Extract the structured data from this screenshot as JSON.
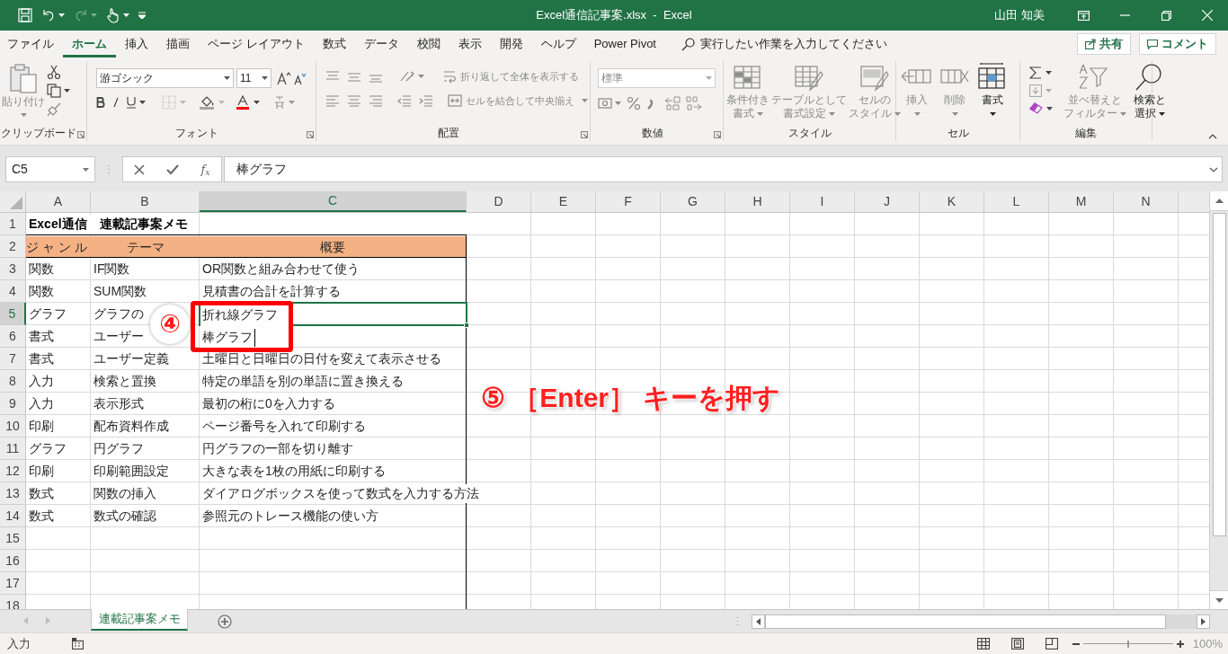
{
  "title_bar": {
    "title": "Excel通信記事案.xlsx  -  Excel",
    "user": "山田 知美"
  },
  "tabs": [
    {
      "label": "ファイル",
      "selected": false
    },
    {
      "label": "ホーム",
      "selected": true
    },
    {
      "label": "挿入",
      "selected": false
    },
    {
      "label": "描画",
      "selected": false
    },
    {
      "label": "ページ レイアウト",
      "selected": false
    },
    {
      "label": "数式",
      "selected": false
    },
    {
      "label": "データ",
      "selected": false
    },
    {
      "label": "校閲",
      "selected": false
    },
    {
      "label": "表示",
      "selected": false
    },
    {
      "label": "開発",
      "selected": false
    },
    {
      "label": "ヘルプ",
      "selected": false
    },
    {
      "label": "Power Pivot",
      "selected": false
    }
  ],
  "tell_me": {
    "placeholder": "実行したい作業を入力してください"
  },
  "share_button": "共有",
  "comment_button": "コメント",
  "ribbon": {
    "groups": [
      {
        "kind": "clipboard",
        "label": "クリップボード",
        "paste": {
          "label": "貼り付け",
          "disabled": true
        }
      },
      {
        "kind": "font",
        "label": "フォント",
        "font_name": "游ゴシック",
        "font_size": "11"
      },
      {
        "kind": "alignment",
        "label": "配置",
        "wrap": {
          "label": "折り返して全体を表示する",
          "disabled": true
        },
        "merge": {
          "label": "セルを結合して中央揃え",
          "disabled": true
        }
      },
      {
        "kind": "number",
        "label": "数値",
        "format": "標準"
      },
      {
        "kind": "styles",
        "label": "スタイル",
        "buttons": [
          {
            "lines": [
              "条件付き",
              "書式"
            ],
            "disabled": true
          },
          {
            "lines": [
              "テーブルとして",
              "書式設定"
            ],
            "disabled": true
          },
          {
            "lines": [
              "セルの",
              "スタイル"
            ],
            "disabled": true
          }
        ]
      },
      {
        "kind": "cells",
        "label": "セル",
        "buttons": [
          {
            "lines": [
              "挿入"
            ],
            "disabled": true
          },
          {
            "lines": [
              "削除"
            ],
            "disabled": true
          },
          {
            "lines": [
              "書式"
            ],
            "disabled": false
          }
        ]
      },
      {
        "kind": "editing",
        "label": "編集",
        "buttons": [
          {
            "lines": [
              "並べ替えと",
              "フィルター"
            ],
            "disabled": true
          },
          {
            "lines": [
              "検索と",
              "選択"
            ],
            "disabled": false
          }
        ]
      }
    ]
  },
  "formula_bar": {
    "name_box": "C5",
    "function_button": "f$_{x}$",
    "formula": "棒グラフ"
  },
  "columns": [
    {
      "label": "A",
      "selected": false
    },
    {
      "label": "B",
      "selected": false
    },
    {
      "label": "C",
      "selected": true
    },
    {
      "label": "D",
      "selected": false
    },
    {
      "label": "E",
      "selected": false
    },
    {
      "label": "F",
      "selected": false
    },
    {
      "label": "G",
      "selected": false
    },
    {
      "label": "H",
      "selected": false
    },
    {
      "label": "I",
      "selected": false
    },
    {
      "label": "J",
      "selected": false
    },
    {
      "label": "K",
      "selected": false
    },
    {
      "label": "L",
      "selected": false
    },
    {
      "label": "M",
      "selected": false
    },
    {
      "label": "N",
      "selected": false
    }
  ],
  "rows": [
    {
      "number": "1",
      "selected": false,
      "kind": "title",
      "a": "Excel通信　連載記事案メモ"
    },
    {
      "number": "2",
      "selected": false,
      "kind": "header",
      "a": "ジャンル",
      "b": "テーマ",
      "c": "概要"
    },
    {
      "number": "3",
      "selected": false,
      "kind": "data",
      "a": "関数",
      "b": "IF関数",
      "c": "OR関数と組み合わせて使う"
    },
    {
      "number": "4",
      "selected": false,
      "kind": "data",
      "a": "関数",
      "b": "SUM関数",
      "c": "見積書の合計を計算する"
    },
    {
      "number": "5",
      "selected": true,
      "kind": "data",
      "a": "グラフ",
      "b": "グラフの"
    },
    {
      "number": "6",
      "selected": false,
      "kind": "data",
      "a": "書式",
      "b": "ユーザー"
    },
    {
      "number": "7",
      "selected": false,
      "kind": "data",
      "a": "書式",
      "b": "ユーザー定義",
      "c": "土曜日と日曜日の日付を変えて表示させる"
    },
    {
      "number": "8",
      "selected": false,
      "kind": "data",
      "a": "入力",
      "b": "検索と置換",
      "c": "特定の単語を別の単語に置き換える"
    },
    {
      "number": "9",
      "selected": false,
      "kind": "data",
      "a": "入力",
      "b": "表示形式",
      "c": "最初の桁に0を入力する"
    },
    {
      "number": "10",
      "selected": false,
      "kind": "data",
      "a": "印刷",
      "b": "配布資料作成",
      "c": "ページ番号を入れて印刷する"
    },
    {
      "number": "11",
      "selected": false,
      "kind": "data",
      "a": "グラフ",
      "b": "円グラフ",
      "c": "円グラフの一部を切り離す"
    },
    {
      "number": "12",
      "selected": false,
      "kind": "data",
      "a": "印刷",
      "b": "印刷範囲設定",
      "c": "大きな表を1枚の用紙に印刷する"
    },
    {
      "number": "13",
      "selected": false,
      "kind": "data",
      "a": "数式",
      "b": "関数の挿入",
      "c": "ダイアログボックスを使って数式を入力する方法"
    },
    {
      "number": "14",
      "selected": false,
      "kind": "data",
      "a": "数式",
      "b": "数式の確認",
      "c": "参照元のトレース機能の使い方"
    },
    {
      "number": "15",
      "selected": false,
      "kind": "empty"
    },
    {
      "number": "16",
      "selected": false,
      "kind": "empty"
    },
    {
      "number": "17",
      "selected": false,
      "kind": "empty"
    },
    {
      "number": "18",
      "selected": false,
      "kind": "empty"
    }
  ],
  "editing_cell": {
    "lines": [
      "折れ線グラフ",
      "棒グラフ"
    ]
  },
  "annotations": {
    "step_badge": "④",
    "callout": "⑤ ［Enter］ キーを押す"
  },
  "sheet_tabs": [
    {
      "label": "連載記事案メモ",
      "selected": true
    }
  ],
  "status_bar": {
    "mode": "入力",
    "zoom": {
      "level": 0.5,
      "reading": "100%"
    }
  }
}
